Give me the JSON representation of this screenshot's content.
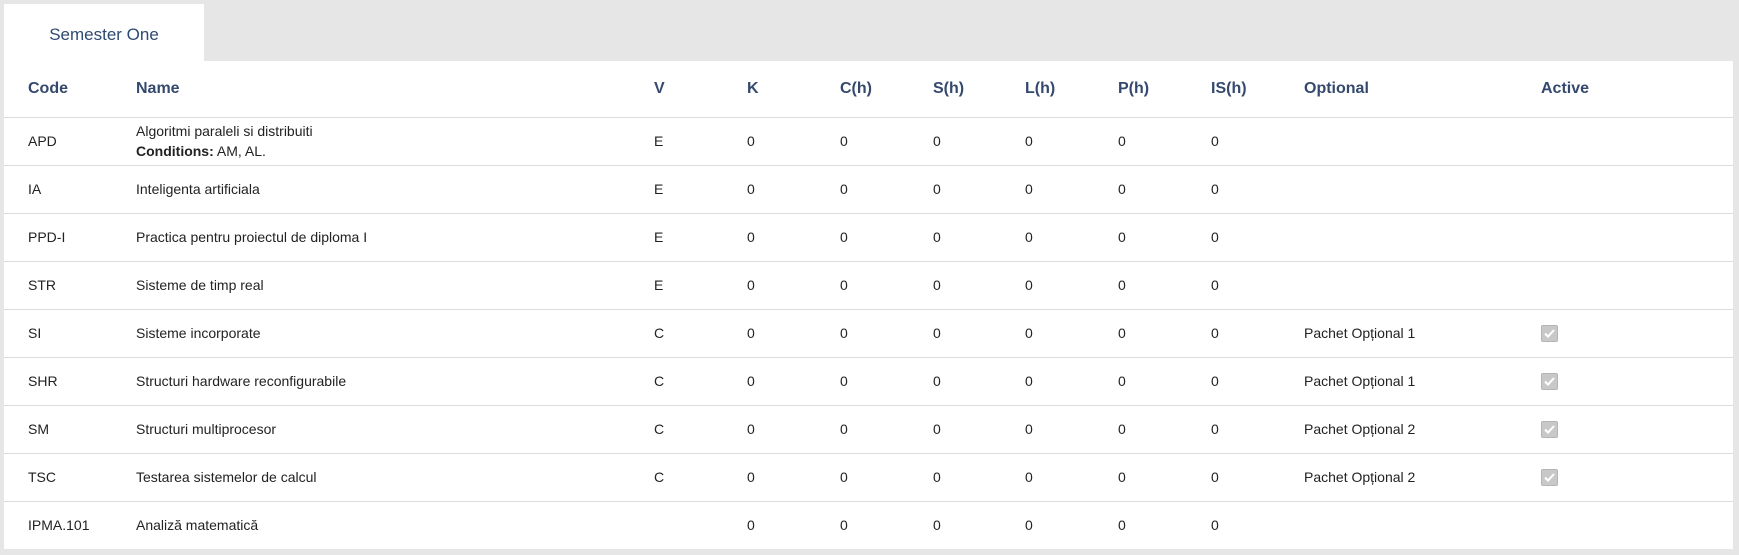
{
  "tabs": [
    {
      "label": "Semester One"
    }
  ],
  "table": {
    "headers": {
      "code": "Code",
      "name": "Name",
      "v": "V",
      "k": "K",
      "c": "C(h)",
      "s": "S(h)",
      "l": "L(h)",
      "p": "P(h)",
      "is": "IS(h)",
      "optional": "Optional",
      "active": "Active"
    },
    "conditions_label": "Conditions:",
    "rows": [
      {
        "code": "APD",
        "name": "Algoritmi paraleli si distribuiti",
        "conditions": "AM, AL.",
        "v": "E",
        "k": "0",
        "c": "0",
        "s": "0",
        "l": "0",
        "p": "0",
        "is": "0",
        "optional": "",
        "active": null
      },
      {
        "code": "IA",
        "name": "Inteligenta artificiala",
        "v": "E",
        "k": "0",
        "c": "0",
        "s": "0",
        "l": "0",
        "p": "0",
        "is": "0",
        "optional": "",
        "active": null
      },
      {
        "code": "PPD-I",
        "name": "Practica pentru proiectul de diploma I",
        "v": "E",
        "k": "0",
        "c": "0",
        "s": "0",
        "l": "0",
        "p": "0",
        "is": "0",
        "optional": "",
        "active": null
      },
      {
        "code": "STR",
        "name": "Sisteme de timp real",
        "v": "E",
        "k": "0",
        "c": "0",
        "s": "0",
        "l": "0",
        "p": "0",
        "is": "0",
        "optional": "",
        "active": null
      },
      {
        "code": "SI",
        "name": "Sisteme incorporate",
        "v": "C",
        "k": "0",
        "c": "0",
        "s": "0",
        "l": "0",
        "p": "0",
        "is": "0",
        "optional": "Pachet Opțional 1",
        "active": true
      },
      {
        "code": "SHR",
        "name": "Structuri hardware reconfigurabile",
        "v": "C",
        "k": "0",
        "c": "0",
        "s": "0",
        "l": "0",
        "p": "0",
        "is": "0",
        "optional": "Pachet Opțional 1",
        "active": true
      },
      {
        "code": "SM",
        "name": "Structuri multiprocesor",
        "v": "C",
        "k": "0",
        "c": "0",
        "s": "0",
        "l": "0",
        "p": "0",
        "is": "0",
        "optional": "Pachet Opțional 2",
        "active": true
      },
      {
        "code": "TSC",
        "name": "Testarea sistemelor de calcul",
        "v": "C",
        "k": "0",
        "c": "0",
        "s": "0",
        "l": "0",
        "p": "0",
        "is": "0",
        "optional": "Pachet Opțional 2",
        "active": true
      },
      {
        "code": "IPMA.101",
        "name": "Analiză matematică",
        "v": "",
        "k": "0",
        "c": "0",
        "s": "0",
        "l": "0",
        "p": "0",
        "is": "0",
        "optional": "",
        "active": null
      }
    ]
  },
  "colors": {
    "header_text": "#34496d",
    "tab_text": "#2e4a72",
    "background": "#e6e6e6",
    "panel": "#ffffff"
  }
}
